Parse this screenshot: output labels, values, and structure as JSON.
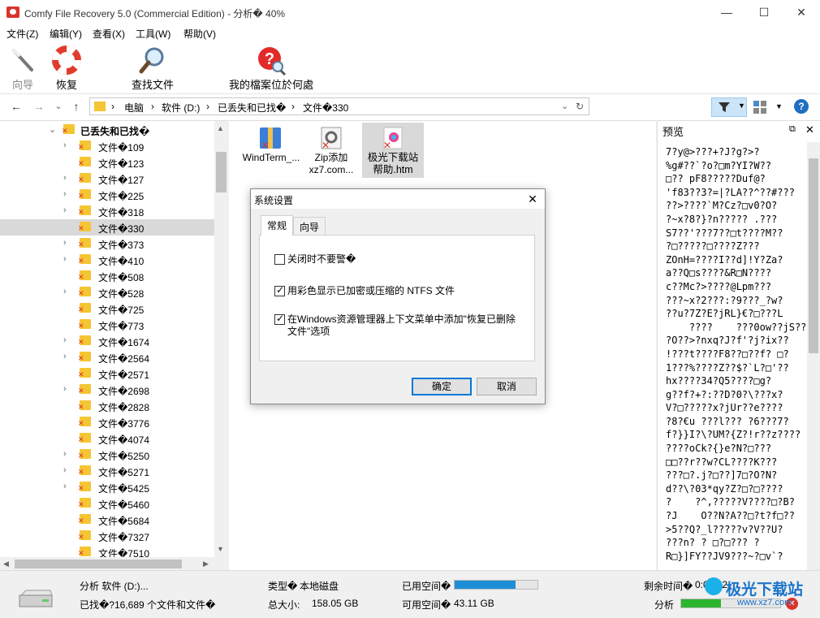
{
  "window": {
    "title": "Comfy File Recovery 5.0 (Commercial Edition) - 分析� 40%",
    "minimize": "—",
    "maximize": "☐",
    "close": "✕"
  },
  "menu": [
    "文件(Z)",
    "编辑(Y)",
    "查看(X)",
    "工具(W)",
    "帮助(V)"
  ],
  "toolbar": {
    "wizard": "向导",
    "recover": "恢复",
    "find": "查找文件",
    "where": "我的檔案位於何處"
  },
  "nav": {
    "back": "←",
    "forward": "→",
    "dropdown": "⌄",
    "up": "↑",
    "crumbs": [
      "电脑",
      "软件 (D:)",
      "已丢失和已找�",
      "文件�330"
    ],
    "sep": "›",
    "addr_dropdown": "⌄",
    "refresh": "↻"
  },
  "tree": {
    "root": "已丢失和已找�",
    "items": [
      {
        "label": "文件�109",
        "chev": true
      },
      {
        "label": "文件�123",
        "chev": false
      },
      {
        "label": "文件�127",
        "chev": true
      },
      {
        "label": "文件�225",
        "chev": true
      },
      {
        "label": "文件�318",
        "chev": true
      },
      {
        "label": "文件�330",
        "chev": false,
        "selected": true
      },
      {
        "label": "文件�373",
        "chev": true
      },
      {
        "label": "文件�410",
        "chev": true
      },
      {
        "label": "文件�508",
        "chev": false
      },
      {
        "label": "文件�528",
        "chev": true
      },
      {
        "label": "文件�725",
        "chev": false
      },
      {
        "label": "文件�773",
        "chev": false
      },
      {
        "label": "文件�1674",
        "chev": true
      },
      {
        "label": "文件�2564",
        "chev": true
      },
      {
        "label": "文件�2571",
        "chev": false
      },
      {
        "label": "文件�2698",
        "chev": true
      },
      {
        "label": "文件�2828",
        "chev": false
      },
      {
        "label": "文件�3776",
        "chev": false
      },
      {
        "label": "文件�4074",
        "chev": false
      },
      {
        "label": "文件�5250",
        "chev": true
      },
      {
        "label": "文件�5271",
        "chev": true
      },
      {
        "label": "文件�5425",
        "chev": true
      },
      {
        "label": "文件�5460",
        "chev": false
      },
      {
        "label": "文件�5684",
        "chev": false
      },
      {
        "label": "文件�7327",
        "chev": false
      },
      {
        "label": "文件�7510",
        "chev": false
      }
    ]
  },
  "files": [
    {
      "name": "WindTerm_...",
      "icon": "winrar-archive-icon"
    },
    {
      "name": "Zip添加\nxz7.com...",
      "icon": "settings-file-icon"
    },
    {
      "name": "极光下载站\n帮助.htm",
      "icon": "html-file-icon",
      "selected": true
    }
  ],
  "preview": {
    "title": "预览",
    "text": "7?y@>???+?J?g?>?\n%g#??`?o?□m?YI?W??\n□?? pF8?????Duf@?\n'f83??3?=|?LA??^??#???\n??>????`M?Cz?□v0?O?\n?~x?8?}?n????? .???\nS7??'???7??□t????M??\n?□?????□????Z???\nZOnH=????I??d]!Y?Za?\na??Q□s????&R□N????\nc??Mc?>????@Lpm???\n???~x?2???:?9???_?w?\n??u?7Z?E?jRL}€?□???L\n    ????    ???0ow??jS??\n?O??>?nxq?J?f'?j?ix??\n!???t????F8??□??f? □?\n1???%????Z??$?`L?□'??\nhx????34?Q5????□g?\ng??f?+?:??D?0?\\???x?\nV?□?????x?jUr??e????\n?8?€u ???l??? ?6???7?\nf?}}I?\\?UM?{Z?!r??z????\n????oCk?{}e?N?□???\n□□??r??w?CL????K???\n???□?.j?□??]7□?O?N?\nd??\\?03*qy?Z?□?□????\n?    ?^,?????V????□?B?\n?J    O??N?A??□?t?f□??\n>5??Q?_l?????v?V??U?\n???n? ? □?□??? ?\nR□}]FY??JV9???~?□v`?"
  },
  "status": {
    "analyzing": "分析 软件 (D:)...",
    "found": "已找�?16,689 个文件和文件�",
    "type_label": "类型�",
    "type_value": "本地磁盘",
    "total_label": "总大小:",
    "total_value": "158.05 GB",
    "used_label": "已用空间�",
    "used_fraction": 0.74,
    "free_label": "可用空间�",
    "free_value": "43.11 GB",
    "remaining_label": "剩余时间�",
    "remaining_value": "0:05:12",
    "progress_label": "分析",
    "progress_fraction": 0.4
  },
  "dialog": {
    "title": "系统设置",
    "close": "✕",
    "tabs": [
      "常规",
      "向导"
    ],
    "checkboxes": [
      {
        "label": "关闭时不要警�",
        "checked": false
      },
      {
        "label": "用彩色显示已加密或压缩的 NTFS 文件",
        "checked": true
      },
      {
        "label": "在Windows资源管理器上下文菜单中添加\"恢复已删除文件\"选项",
        "checked": true
      }
    ],
    "ok": "确定",
    "cancel": "取消"
  },
  "watermark": "极光下载站",
  "watermark_url": "www.xz7.com",
  "colors": {
    "accent": "#0078d7",
    "progress": "#1e8fd6",
    "folder": "#f5c533",
    "deleted_mark": "#d9342b"
  }
}
